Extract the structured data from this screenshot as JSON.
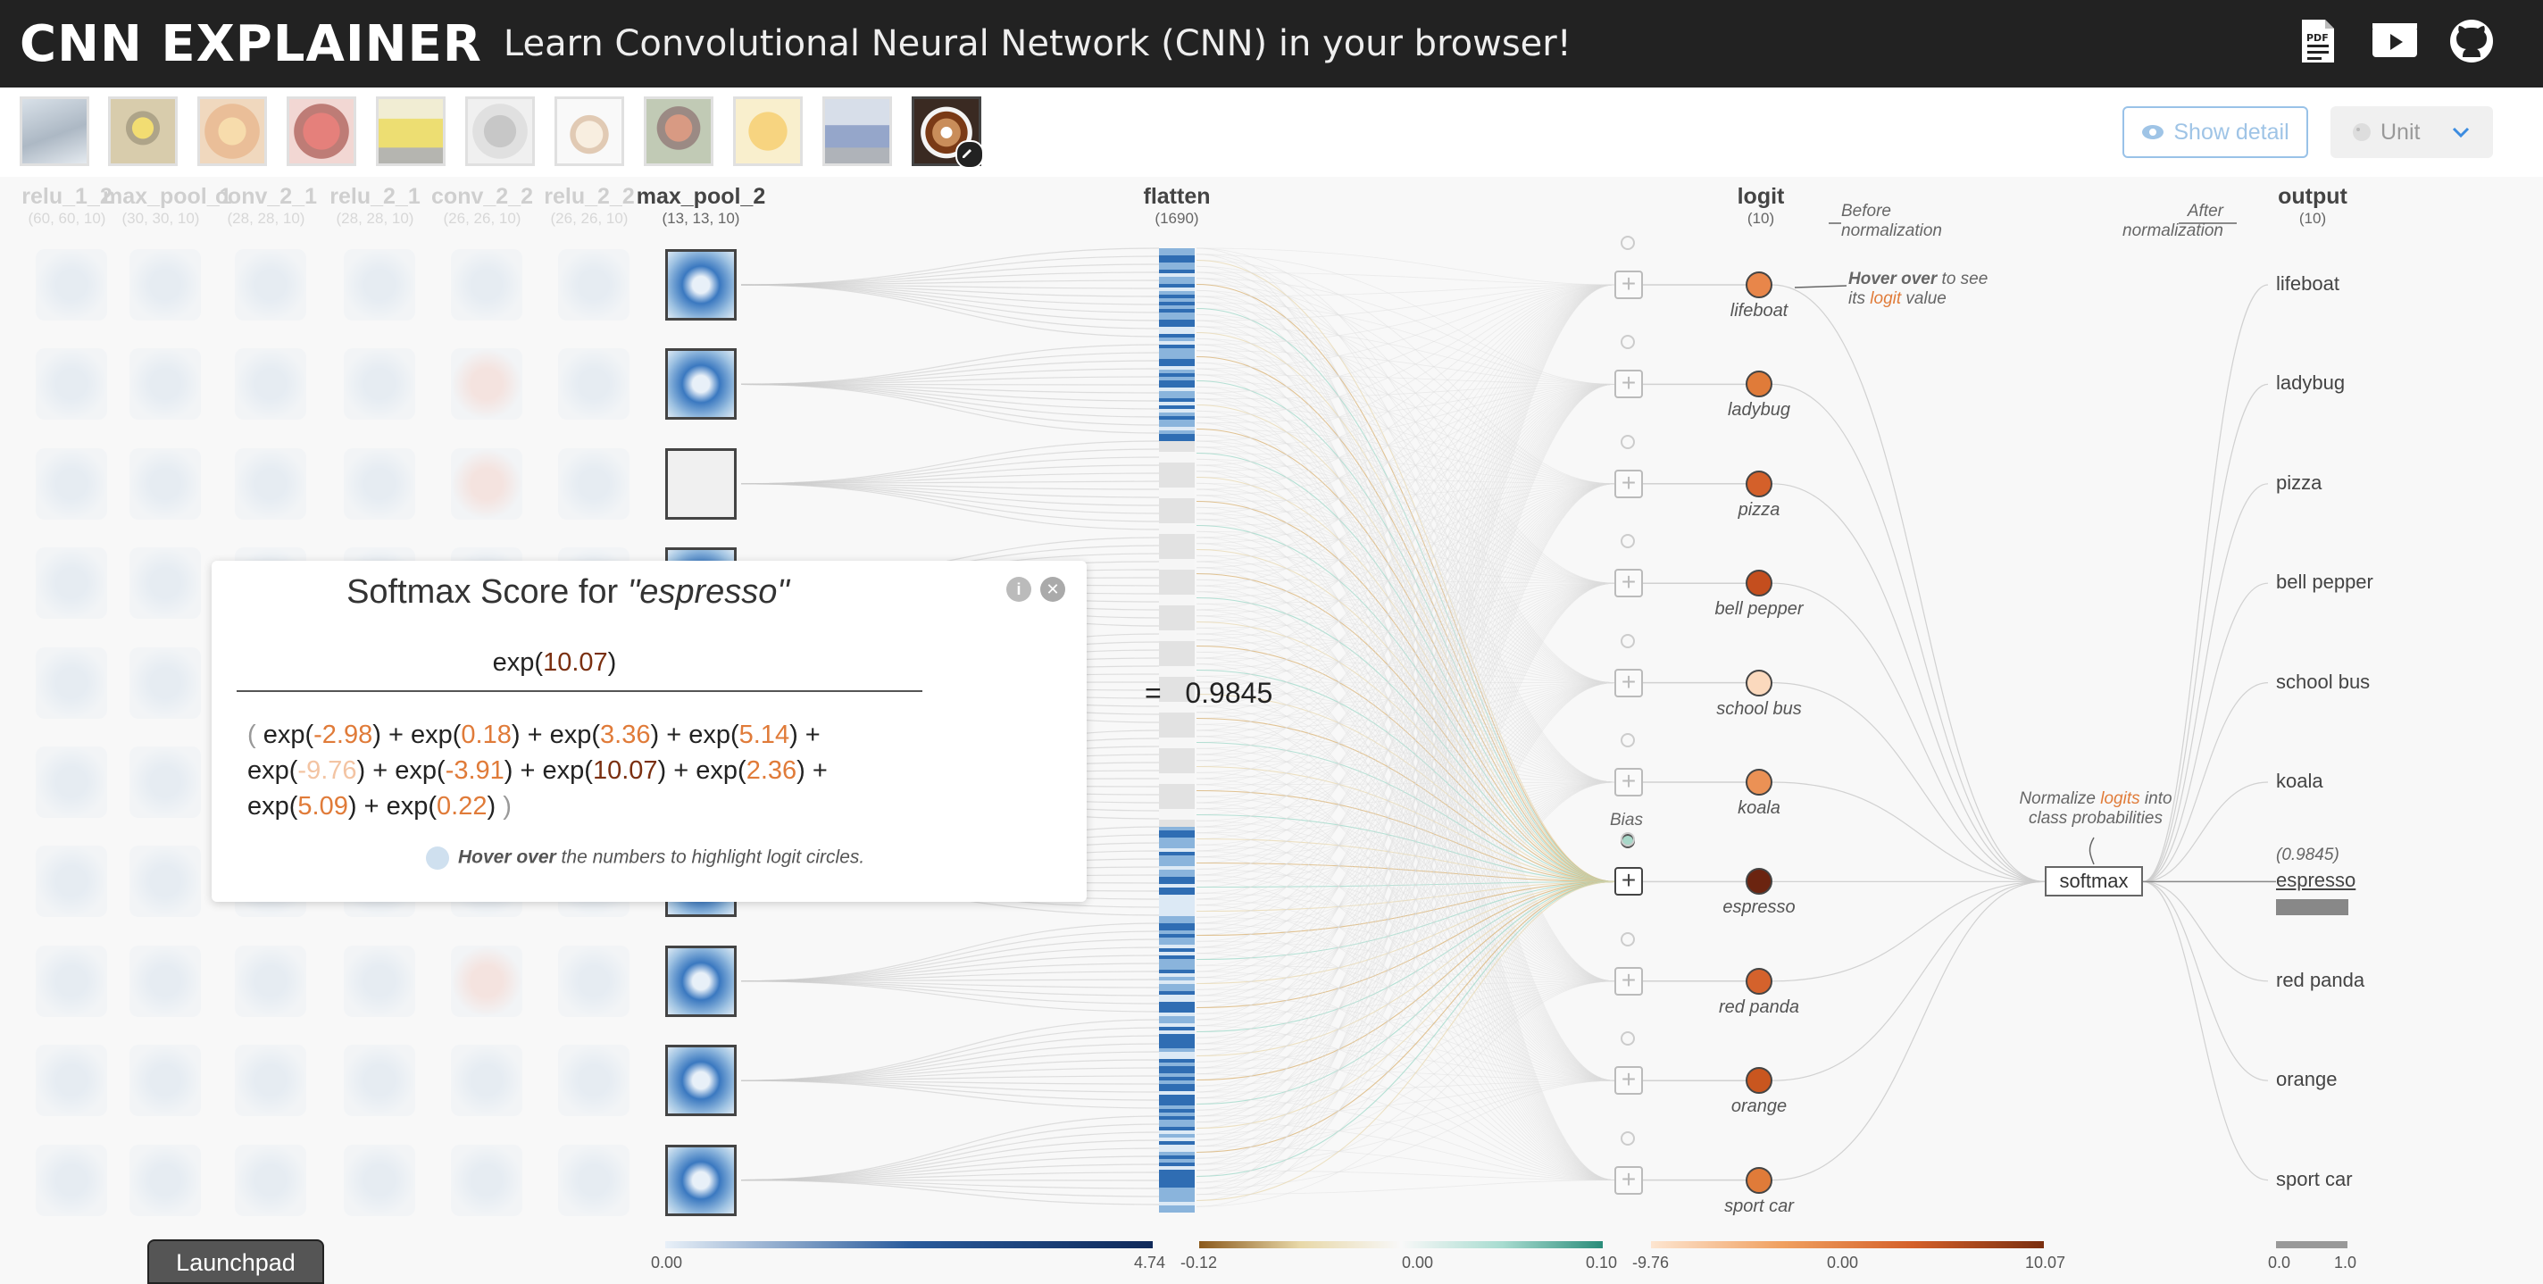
{
  "header": {
    "logo": "CNN EXPLAINER",
    "tagline": "Learn Convolutional Neural Network (CNN) in your browser!",
    "icons": [
      "paper-icon",
      "video-icon",
      "github-icon"
    ]
  },
  "image_bar": {
    "thumbnails": [
      "lifeboat",
      "ladybug",
      "pizza",
      "bell pepper",
      "school bus",
      "koala",
      "espresso",
      "red panda",
      "orange",
      "sport car",
      "custom"
    ],
    "selected_index": 10
  },
  "controls": {
    "show_detail": "Show detail",
    "unit": "Unit"
  },
  "layers": {
    "faded": [
      {
        "name": "relu_1_2",
        "dim": "(60, 60, 10)"
      },
      {
        "name": "max_pool_1",
        "dim": "(30, 30, 10)"
      },
      {
        "name": "conv_2_1",
        "dim": "(28, 28, 10)"
      },
      {
        "name": "relu_2_1",
        "dim": "(28, 28, 10)"
      },
      {
        "name": "conv_2_2",
        "dim": "(26, 26, 10)"
      },
      {
        "name": "relu_2_2",
        "dim": "(26, 26, 10)"
      }
    ],
    "max_pool_2": {
      "name": "max_pool_2",
      "dim": "(13, 13, 10)"
    },
    "flatten": {
      "name": "flatten",
      "dim": "(1690)"
    },
    "logit": {
      "name": "logit",
      "dim": "(10)"
    },
    "output": {
      "name": "output",
      "dim": "(10)"
    }
  },
  "annotations": {
    "before_norm": "Before normalization",
    "after_norm": "After normalization",
    "hover_bold": "Hover over",
    "hover_rest1": " to see",
    "hover_line2_a": "its ",
    "hover_logit": "logit",
    "hover_line2_b": " value",
    "normalize_a": "Normalize ",
    "normalize_logits": "logits",
    "normalize_b": " into",
    "normalize_line2": "class probabilities",
    "bias": "Bias",
    "softmax": "softmax"
  },
  "classes": [
    "lifeboat",
    "ladybug",
    "pizza",
    "bell pepper",
    "school bus",
    "koala",
    "espresso",
    "red panda",
    "orange",
    "sport car"
  ],
  "logits": [
    -2.98,
    0.18,
    3.36,
    5.14,
    -9.76,
    -3.91,
    10.07,
    2.36,
    5.09,
    0.22
  ],
  "logit_colors": [
    "#e8864a",
    "#e07b39",
    "#d4602a",
    "#c44e1e",
    "#fbd9bd",
    "#eb9155",
    "#6b2410",
    "#d4622c",
    "#c9561f",
    "#e07b39"
  ],
  "output": {
    "selected_class": "espresso",
    "selected_prob": "(0.9845)",
    "probability": 0.9845
  },
  "popup": {
    "title_prefix": "Softmax Score for ",
    "title_class": "\"espresso\"",
    "numerator_fn": "exp(",
    "numerator_val": "10.07",
    "numerator_close": ")",
    "equals": "=",
    "result": "0.9845",
    "hint_bold": "Hover over",
    "hint_rest": " the numbers to highlight logit circles."
  },
  "launchpad": "Launchpad",
  "legends": {
    "maxpool": {
      "min": "0.00",
      "max": "4.74"
    },
    "flatten_weights": {
      "min": "-0.12",
      "mid": "0.00",
      "max": "0.10"
    },
    "logit": {
      "min": "-9.76",
      "mid": "0.00",
      "max": "10.07"
    },
    "output": {
      "min": "0.0",
      "max": "1.0"
    }
  }
}
